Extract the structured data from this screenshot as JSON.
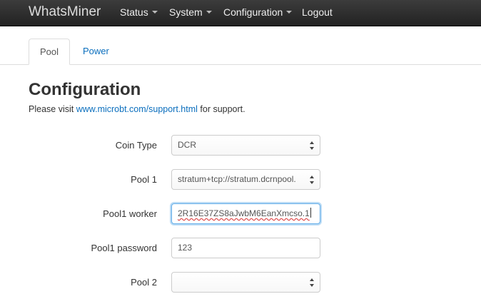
{
  "navbar": {
    "brand": "WhatsMiner",
    "items": [
      {
        "label": "Status",
        "dropdown": true
      },
      {
        "label": "System",
        "dropdown": true
      },
      {
        "label": "Configuration",
        "dropdown": true
      },
      {
        "label": "Logout",
        "dropdown": false
      }
    ]
  },
  "tabs": [
    {
      "label": "Pool",
      "active": true
    },
    {
      "label": "Power",
      "active": false
    }
  ],
  "main": {
    "title": "Configuration",
    "support_prefix": "Please visit",
    "support_link": "www.microbt.com/support.html",
    "support_suffix": "for support."
  },
  "form": {
    "coin_type": {
      "label": "Coin Type",
      "value": "DCR"
    },
    "pool1": {
      "label": "Pool 1",
      "value": "stratum+tcp://stratum.dcrnpool."
    },
    "pool1_worker": {
      "label": "Pool1 worker",
      "value": "2R16E37ZS8aJwbM6EanXmcso.1"
    },
    "pool1_password": {
      "label": "Pool1 password",
      "value": "123"
    },
    "pool2": {
      "label": "Pool 2",
      "value": ""
    }
  },
  "colors": {
    "navbar_bg": "#222222",
    "link": "#0a6ebd",
    "focus_ring": "#66afe9"
  }
}
